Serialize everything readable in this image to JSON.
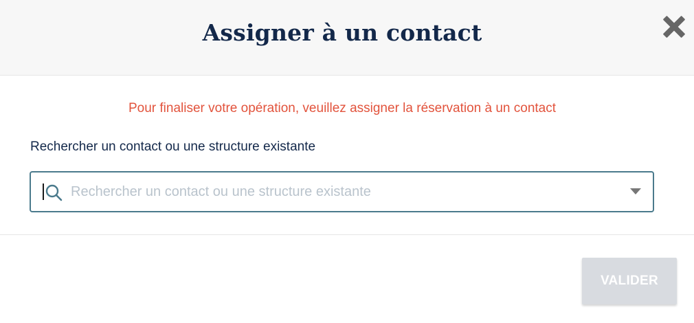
{
  "modal": {
    "title": "Assigner à un contact",
    "close_icon": "close-icon"
  },
  "warning": {
    "text": "Pour finaliser votre opération, veuillez assigner la réservation à un contact",
    "color": "#e2533c"
  },
  "search": {
    "label": "Rechercher un contact ou une structure existante",
    "placeholder": "Rechercher un contact ou une structure existante",
    "value": "",
    "icon": "search-icon",
    "dropdown_icon": "chevron-down-icon",
    "border_color": "#4a7a8c"
  },
  "footer": {
    "validate_label": "VALIDER",
    "validate_disabled": true
  },
  "colors": {
    "title": "#13284a",
    "header_bg": "#f7f7f7",
    "button_disabled_bg": "#d8dbe0"
  }
}
